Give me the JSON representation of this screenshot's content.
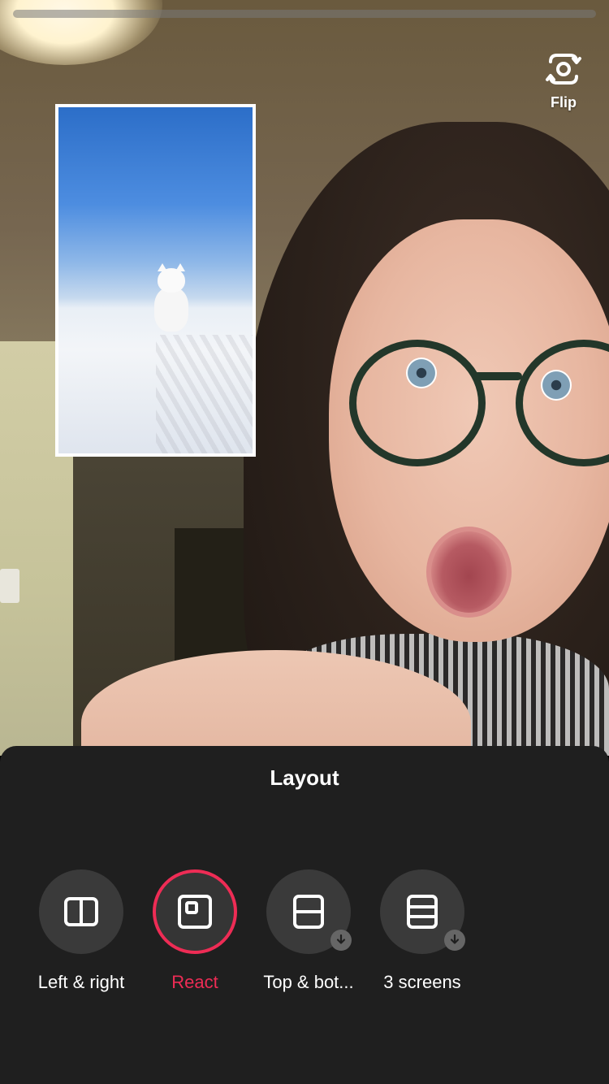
{
  "progress": {
    "value": 0.98,
    "accent": "#29d14e"
  },
  "flip": {
    "label": "Flip",
    "icon": "flip-camera-icon"
  },
  "react_overlay": {
    "description_icon": "white-cat-in-snow-video"
  },
  "sheet": {
    "title": "Layout",
    "options": [
      {
        "label": "Left & right",
        "icon": "split-left-right-icon",
        "selected": false,
        "download": false
      },
      {
        "label": "React",
        "icon": "react-pip-icon",
        "selected": true,
        "download": false
      },
      {
        "label": "Top & bot...",
        "icon": "split-top-bottom-icon",
        "selected": false,
        "download": true
      },
      {
        "label": "3 screens",
        "icon": "three-screens-icon",
        "selected": false,
        "download": true
      }
    ],
    "accent": "#ee2c55"
  }
}
